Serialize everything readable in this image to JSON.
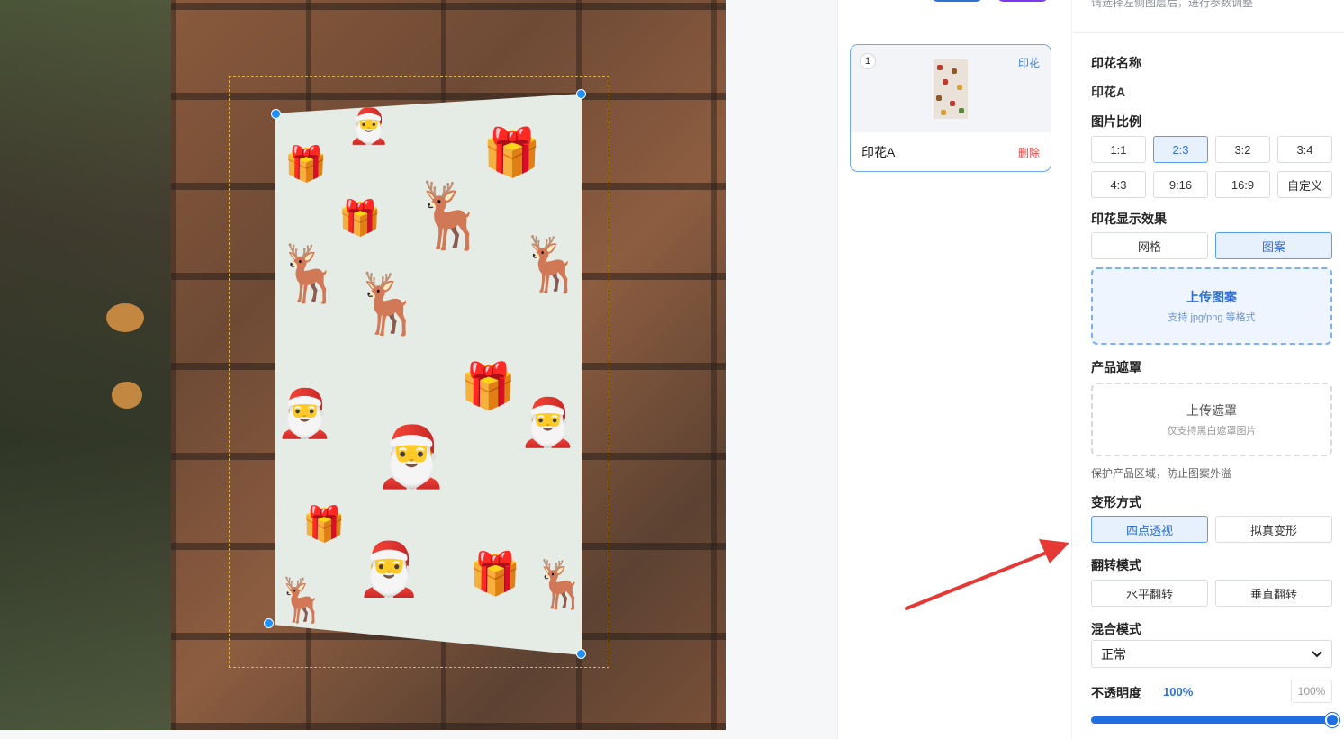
{
  "layers_panel": {
    "layers": [
      {
        "index": "1",
        "tag": "印花",
        "name": "印花A",
        "delete_label": "删除"
      }
    ]
  },
  "settings": {
    "hint": "请选择左侧图层后，进行参数调整",
    "print_name": {
      "label": "印花名称",
      "value": "印花A"
    },
    "aspect_ratio": {
      "label": "图片比例",
      "options": [
        "1:1",
        "2:3",
        "3:2",
        "3:4",
        "4:3",
        "9:16",
        "16:9",
        "自定义"
      ],
      "selected": "2:3"
    },
    "display_effect": {
      "label": "印花显示效果",
      "options": [
        "网格",
        "图案"
      ],
      "selected": "图案",
      "upload_pattern": {
        "title": "上传图案",
        "subtitle": "支持 jpg/png 等格式"
      }
    },
    "product_mask": {
      "label": "产品遮罩",
      "upload_mask": {
        "title": "上传遮罩",
        "subtitle": "仅支持黑白遮罩图片"
      },
      "note": "保护产品区域，防止图案外溢"
    },
    "transform": {
      "label": "变形方式",
      "options": [
        "四点透视",
        "拟真变形"
      ],
      "selected": "四点透视"
    },
    "flip": {
      "label": "翻转模式",
      "options": [
        "水平翻转",
        "垂直翻转"
      ]
    },
    "blend": {
      "label": "混合模式",
      "value": "正常"
    },
    "opacity": {
      "label": "不透明度",
      "display": "100%",
      "input_value": "100%",
      "level": 1.0
    }
  },
  "colors": {
    "accent": "#2f6fd6",
    "handle": "#1e90ff",
    "guide": "#e0b53a",
    "arrow": "#e53935",
    "danger": "#ef4444"
  }
}
